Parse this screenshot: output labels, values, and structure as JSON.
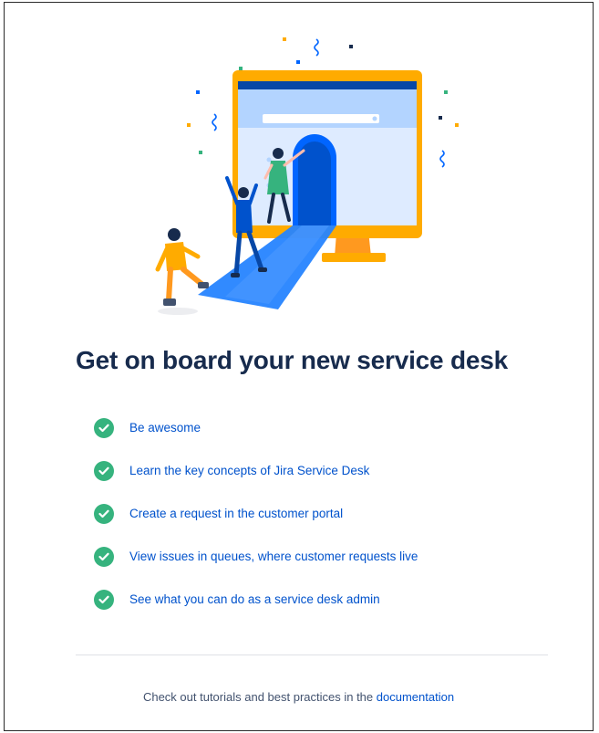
{
  "page": {
    "heading": "Get on board your new service desk"
  },
  "checklist": [
    {
      "label": "Be awesome",
      "done": true
    },
    {
      "label": "Learn the key concepts of Jira Service Desk",
      "done": true
    },
    {
      "label": "Create a request in the customer portal",
      "done": true
    },
    {
      "label": "View issues in queues, where customer requests live",
      "done": true
    },
    {
      "label": "See what you can do as a service desk admin",
      "done": true
    }
  ],
  "footer": {
    "text": "Check out tutorials and best practices in the",
    "link_label": "documentation"
  },
  "colors": {
    "heading": "#172b4d",
    "link": "#0052cc",
    "check": "#36b37e",
    "monitor": "#ffab00",
    "portal": "#0065ff"
  },
  "icons": {
    "check": "check-circle-icon",
    "illustration": "onboarding-illustration"
  }
}
